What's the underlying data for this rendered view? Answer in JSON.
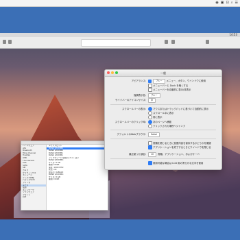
{
  "top_menubar": {
    "status_items": [
      "◉",
      "▣",
      "⊡",
      "⌕",
      "☰"
    ]
  },
  "screen": {
    "clock": "14:53",
    "safari": {
      "url": ""
    }
  },
  "prefs": {
    "title": "一般",
    "rows": [
      {
        "label": "アピアランス:",
        "control": "ブルー",
        "text": "メニュー、ボタン、ウインドウに使用"
      },
      {
        "label": "",
        "control": "",
        "text": "メニューバーと Dock を暗くする"
      },
      {
        "label": "",
        "control": "",
        "text": "メニューバーを自動的に表示/非表示"
      },
      {
        "label": "強調表示色:",
        "control": "ブルー",
        "text": ""
      },
      {
        "label": "サイドバーのアイコンサイズ:",
        "control": "中",
        "text": ""
      },
      {
        "label": "スクロールバーの表示:",
        "control": "",
        "text": "マウスまたはトラックパッドに基づいて自動的に表示"
      },
      {
        "label": "",
        "control": "",
        "text": "スクロール中に表示"
      },
      {
        "label": "",
        "control": "",
        "text": "常に表示"
      },
      {
        "label": "スクロールバーのクリック時:",
        "control": "",
        "text": "次のページへ移動"
      },
      {
        "label": "",
        "control": "",
        "text": "クリックされた場所へジャンプ"
      },
      {
        "label": "デフォルトのWebブラウザ:",
        "control": "Safari",
        "text": ""
      },
      {
        "label": "",
        "control": "",
        "text": "書類を閉じるときに変更内容を保存するかどうかを確認"
      },
      {
        "label": "",
        "control": "",
        "text": "アプリケーションを終了するときにウインドウを閉じる"
      },
      {
        "label": "最近使った項目:",
        "control": "10",
        "text": "書類、アプリケーション、およびサーバ"
      },
      {
        "label": "",
        "control": "",
        "text": "使用可能な場合は LCD 用の滑らかな文字を使用"
      }
    ]
  },
  "sysinfo": {
    "sidebar": [
      "ハードウェア",
      "ATA",
      "Bluetooth",
      "Fibre Channel",
      "FireWire",
      "USB",
      "Thunderbolt",
      "SAS",
      "SATA",
      "SPI",
      "カメラ",
      "グラフィックス",
      "ストレージ",
      "ディスク作成",
      "パラレルSCSI",
      "プリンタ",
      "メモリ",
      "電源",
      "ネットワーク",
      "ソフトウェア",
      "フォント",
      "ログ"
    ],
    "main": [
      "メモリスロット",
      "BANK 0/DIMM0",
      "BANK 1/DIMM0",
      "BANK 0/DIMM1",
      "BANK 1/DIMM1",
      "",
      "アップグレード可能なメモリ: はい",
      "",
      "BANK 0/DIMM0:",
      "サイズ: 8 GB",
      "種類: DDR3",
      "速度: 1600 MHz",
      "状況: OK",
      "製造元: 0x80AD",
      "",
      "BANK 1/DIMM0:",
      "サイズ: 8 GB",
      "種類: DDR3"
    ]
  },
  "colors": {
    "desktop": "#3b6fb6",
    "accent": "#2e7cf6"
  }
}
